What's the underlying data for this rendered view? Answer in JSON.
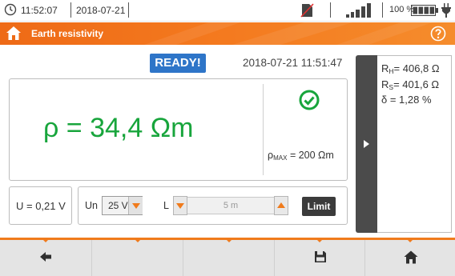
{
  "status_bar": {
    "time": "11:52:07",
    "date": "2018-07-21",
    "battery_percent": "100 %",
    "icons": [
      "clock-icon",
      "no-sim-icon",
      "signal-strength-icon",
      "battery-full-icon",
      "power-plug-icon"
    ]
  },
  "title_bar": {
    "title": "Earth resistivity",
    "icons": [
      "home-icon",
      "help-icon"
    ]
  },
  "status": {
    "badge": "READY!",
    "timestamp": "2018-07-21 11:51:47",
    "badge_color": "#2e75c8"
  },
  "result": {
    "main": "ρ = 34,4 Ωm",
    "ok_icon": "check-circle-icon",
    "rho_max_symbol": "ρ",
    "rho_max_sub": "MAX",
    "rho_max_value": " = 200 Ωm",
    "main_color": "#18a53c"
  },
  "side_results": {
    "rh_symbol": "R",
    "rh_sub": "H",
    "rh_value": "= 406,8 Ω",
    "rs_symbol": "R",
    "rs_sub": "S",
    "rs_value": "= 401,6 Ω",
    "delta": "δ  = 1,28 %"
  },
  "measurement": {
    "voltage": "U = 0,21 V"
  },
  "settings": {
    "un_label": "Un",
    "un_value": "25 V",
    "l_label": "L",
    "l_value": "5 m",
    "limit_label": "Limit"
  },
  "toolbar": {
    "buttons": [
      "back-icon",
      "",
      "",
      "save-icon",
      "home-icon"
    ]
  },
  "colors": {
    "accent": "#f07b1c",
    "dark": "#3b3b3b"
  }
}
